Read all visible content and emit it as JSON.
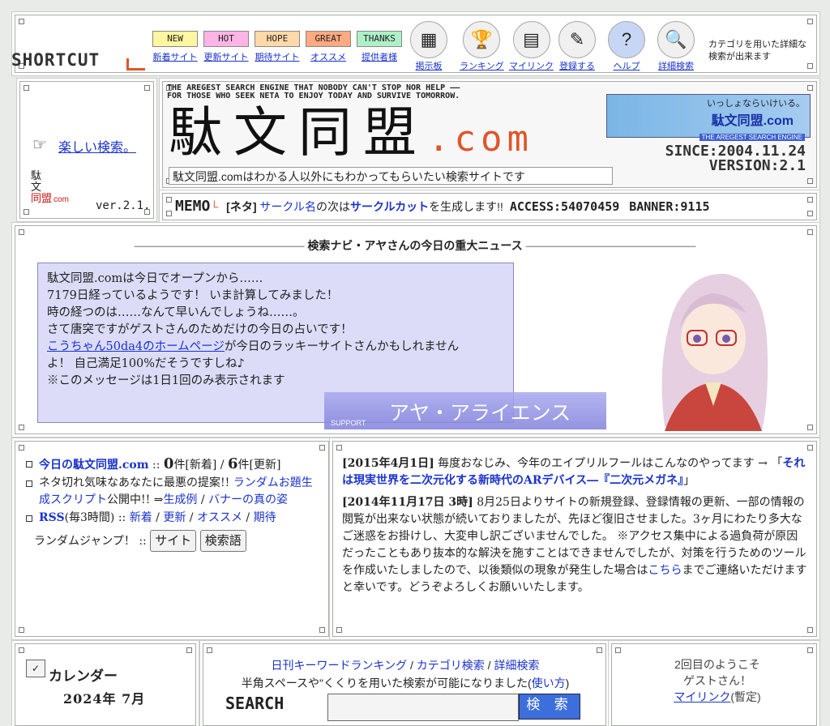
{
  "shortcut": {
    "title": "SHORTCUT",
    "tags": [
      {
        "tag": "NEW",
        "label": "新着サイト",
        "color": "#fff6a0"
      },
      {
        "tag": "HOT",
        "label": "更新サイト",
        "color": "#ffb4e6"
      },
      {
        "tag": "HOPE",
        "label": "期待サイト",
        "color": "#ffd9a8"
      },
      {
        "tag": "GREAT",
        "label": "オススメ",
        "color": "#ffaa80"
      },
      {
        "tag": "THANKS",
        "label": "提供者様",
        "color": "#aef0c8"
      }
    ],
    "icons": [
      {
        "icon": "board-icon",
        "label": "掲示板",
        "glyph": "▦"
      },
      {
        "icon": "trophy-icon",
        "label": "ランキング",
        "glyph": "🏆"
      },
      {
        "icon": "treasure-chest-icon",
        "label": "マイリンク",
        "glyph": "▤"
      },
      {
        "icon": "pen-icon",
        "label": "登録する",
        "glyph": "✎"
      },
      {
        "icon": "help-icon",
        "label": "ヘルプ",
        "glyph": "?"
      },
      {
        "icon": "magnifier-icon",
        "label": "詳細検索",
        "glyph": "🔍"
      }
    ],
    "note": "カテゴリを用いた詳細な検索が出来ます"
  },
  "side": {
    "link": "楽しい検索。",
    "name_line1": "駄",
    "name_line2": "文",
    "name_line3": "同盟",
    "name_suffix": "com",
    "version": "ver.2.1."
  },
  "header": {
    "tagline1": "THE AREGEST SEARCH ENGINE THAT NOBODY CAN'T STOP NOR HELP ――",
    "tagline2": "FOR THOSE WHO SEEK NETA TO ENJOY TODAY AND SURVIVE TOMORROW.",
    "logo": "駄文同盟",
    "logo_suffix": ".com",
    "subtitle": "駄文同盟.comはわかる人以外にもわかってもらいたい検索サイトです",
    "banner_line1": "いっしょならいけいる。",
    "banner_line2": "駄文同盟.com",
    "banner_line3": "THE AREGEST SEARCH ENGINE",
    "since": "SINCE:2004.11.24",
    "version": "VERSION:2.1"
  },
  "memo": {
    "label": "MEMO",
    "prefix": "[ネタ] ",
    "link1": "サークル名",
    "mid": "の次は",
    "link2": "サークルカット",
    "suffix": "を生成します!!",
    "access": "ACCESS:54070459",
    "banner_count": "BANNER:9115"
  },
  "news": {
    "title": "検索ナビ・アヤさんの今日の重大ニュース",
    "line1": "駄文同盟.comは今日でオープンから……",
    "line2": "7179日経っているようです！ いま計算してみました！",
    "line3": "時の経つのは……なんて早いんでしょうね……。",
    "line4": "さて唐突ですがゲストさんのためだけの今日の占いです！",
    "lucky_link": "こうちゃん50da4のホームページ",
    "line5_after": "が今日のラッキーサイトさんかもしれません",
    "line6": "よ！ 自己満足100%だそうですしね♪",
    "line7": "※このメッセージは1日1回のみ表示されます",
    "support_label": "SUPPORT",
    "support_title": "アヤ・アライエンス"
  },
  "info": {
    "today_link": "今日の駄文同盟.com",
    "today_sep": " :: ",
    "new_count": "0",
    "new_label": "件[新着] / ",
    "upd_count": "6",
    "upd_label": "件[更新]",
    "neta_text": "ネタ切れ気味なあなたに最悪の提案!! ",
    "neta_link": "ランダムお題生成スクリプト",
    "neta_pub": "公開中!! ⇒",
    "neta_example": "生成例",
    "neta_slash": " / ",
    "neta_banner": "バナーの真の姿",
    "rss_link": "RSS",
    "rss_text": "(毎3時間) :: ",
    "rss_new": "新着",
    "rss_upd": "更新",
    "rss_rec": "オススメ",
    "rss_exp": "期待",
    "random_label": "ランダムジャンプ！ :: ",
    "random_site": "サイト",
    "random_keyword": "検索語"
  },
  "announce": {
    "date1": "[2015年4月1日]",
    "text1": " 毎度おなじみ、今年のエイプリルフールはこんなのやってます → 「",
    "link1": "それは現実世界を二次元化する新時代のARデバイス―『二次元メガネ』",
    "close1": "」",
    "date2": "[2014年11月17日 3時]",
    "text2": " 8月25日よりサイトの新規登録、登録情報の更新、一部の情報の閲覧が出来ない状態が続いておりましたが、先ほど復旧させました。3ヶ月にわたり多大なご迷惑をお掛けし、大変申し訳ございませんでした。 ※アクセス集中による過負荷が原因だったこともあり抜本的な解決を施すことはできませんでしたが、対策を行うためのツールを作成いたしましたので、以後類似の現象が発生した場合は",
    "link2": "こちら",
    "text2b": "までご連絡いただけますと幸いです。どうぞよろしくお願いいたします。"
  },
  "calendar": {
    "title": "カレンダー",
    "month": "2024年 7月"
  },
  "search": {
    "link_ranking": "日刊キーワードランキング",
    "link_category": "カテゴリ検索",
    "link_detail": "詳細検索",
    "hint": "半角スペースや\"くくりを用いた検索が可能になりました(",
    "hint_link": "使い方",
    "hint_end": ")",
    "logo": "SEARCH",
    "button": "検 索"
  },
  "welcome": {
    "line1": "2回目のようこそ",
    "line2": "ゲストさん！",
    "mylink": "マイリンク",
    "mylink_note": "(暫定)"
  }
}
